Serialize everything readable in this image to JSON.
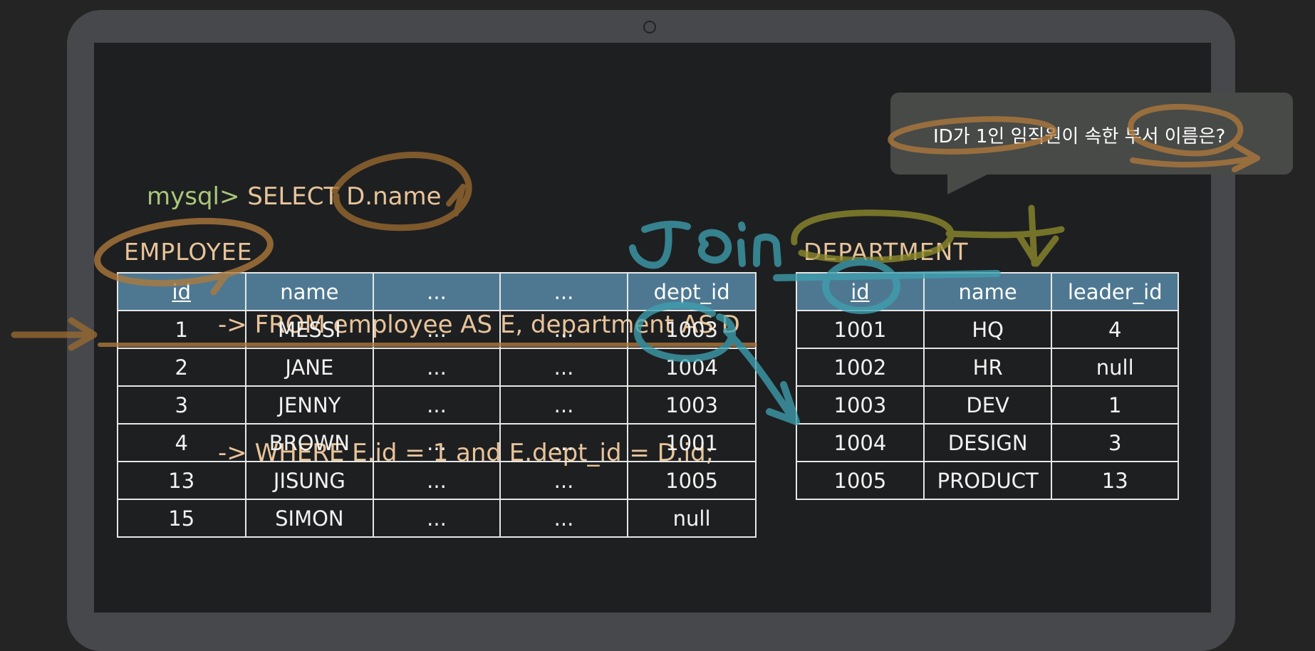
{
  "query": {
    "prompt": "mysql>",
    "line1": "SELECT D.name",
    "arrow": "->",
    "line2": "FROM employee AS E, department AS D",
    "line3": "WHERE E.id = 1 and E.dept_id = D.id;"
  },
  "callout": {
    "text": "ID가 1인 임직원이 속한 부서 이름은?"
  },
  "annotation": {
    "join": "Join"
  },
  "employee": {
    "title": "EMPLOYEE",
    "headers": [
      "id",
      "name",
      "...",
      "...",
      "dept_id"
    ],
    "rows": [
      [
        "1",
        "MESSI",
        "...",
        "...",
        "1003"
      ],
      [
        "2",
        "JANE",
        "...",
        "...",
        "1004"
      ],
      [
        "3",
        "JENNY",
        "...",
        "...",
        "1003"
      ],
      [
        "4",
        "BROWN",
        "...",
        "...",
        "1001"
      ],
      [
        "13",
        "JISUNG",
        "...",
        "...",
        "1005"
      ],
      [
        "15",
        "SIMON",
        "...",
        "...",
        "null"
      ]
    ]
  },
  "department": {
    "title": "DEPARTMENT",
    "headers": [
      "id",
      "name",
      "leader_id"
    ],
    "rows": [
      [
        "1001",
        "HQ",
        "4"
      ],
      [
        "1002",
        "HR",
        "null"
      ],
      [
        "1003",
        "DEV",
        "1"
      ],
      [
        "1004",
        "DESIGN",
        "3"
      ],
      [
        "1005",
        "PRODUCT",
        "13"
      ]
    ]
  },
  "colors": {
    "header_bg": "#4e7891",
    "sql_text": "#e8c49a",
    "prompt": "#a9c779",
    "marker_orange": "#b07a3c",
    "marker_cyan": "#3f9fb0",
    "marker_olive": "#8a8a2a"
  }
}
